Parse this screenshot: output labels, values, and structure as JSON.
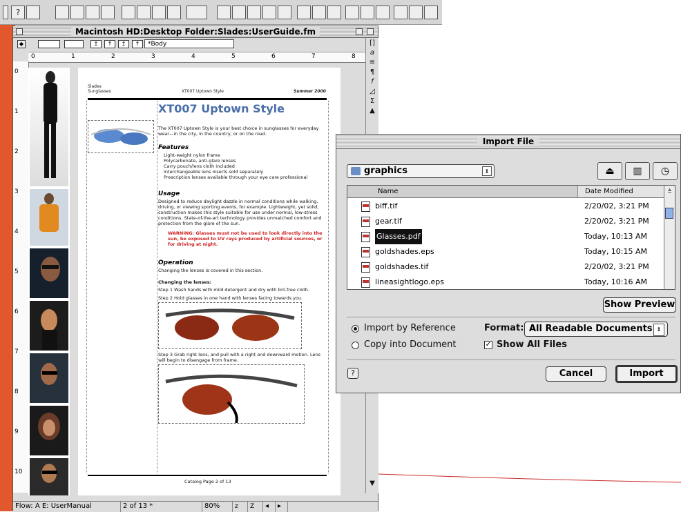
{
  "toolbar": {
    "buttons": [
      "?",
      "▤",
      "▢",
      "📂",
      "💾",
      "🖨",
      "✂",
      "⎘",
      "📋",
      "✎"
    ]
  },
  "document_window": {
    "title": "Macintosh HD:Desktop Folder:Slades:UserGuide.fm",
    "paragraph_tag": "*Body",
    "ruler_numbers": [
      "0",
      "1",
      "2",
      "3",
      "4",
      "5",
      "6",
      "7",
      "8"
    ],
    "left_ruler_numbers": [
      "0",
      "1",
      "2",
      "3",
      "4",
      "5",
      "6",
      "7",
      "8",
      "9",
      "10"
    ]
  },
  "page": {
    "header_left_1": "Slades",
    "header_left_2": "Sunglasses",
    "header_center": "XT007 Uptown Style",
    "header_right": "Summer 2000",
    "title": "XT007 Uptown Style",
    "intro": "The XT007 Uptown Style is your best choice in sunglasses for everyday wear—in the city, in the country, or on the road.",
    "features_heading": "Features",
    "features": [
      "Light-weight nylon frame",
      "Polycarbonate, anti-glare lenses",
      "Carry pouch/lens cloth included",
      "Interchangeable lens inserts sold separately",
      "Prescription lenses available through your eye care professional"
    ],
    "usage_heading": "Usage",
    "usage_text": "Designed to reduce daylight dazzle in normal conditions while walking, driving, or viewing sporting events, for example. Lightweight, yet solid, construction makes this style suitable for use under normal, low-stress conditions. State-of-the-art technology provides unmatched comfort and protection from the glare of the sun.",
    "warning": "WARNING: Glasses must not be used to look directly into the sun, be exposed to UV rays produced by artificial sources, or for driving at night.",
    "operation_heading": "Operation",
    "operation_text": "Changing the lenses is covered in this section.",
    "changing_heading": "Changing the lenses:",
    "step1": "Step 1   Wash hands with mild detergent and dry with lint-free cloth.",
    "step2": "Step 2   Hold glasses in one hand with lenses facing towards you.",
    "step3": "Step 3   Grab right lens, and pull with a right and downward motion. Lens will begin to disengage from frame.",
    "footer": "Catalog Page 2 of 13"
  },
  "status_bar": {
    "flow": "Flow: A  E: UserManual",
    "page": "2 of 13 *",
    "zoom": "80%"
  },
  "dialog": {
    "title": "Import File",
    "folder": "graphics",
    "col_name": "Name",
    "col_date": "Date Modified",
    "files": [
      {
        "name": "biff.tif",
        "date": "2/20/02, 3:21 PM"
      },
      {
        "name": "gear.tif",
        "date": "2/20/02, 3:21 PM"
      },
      {
        "name": "Glasses.pdf",
        "date": "Today, 10:13 AM"
      },
      {
        "name": "goldshades.eps",
        "date": "Today, 10:15 AM"
      },
      {
        "name": "goldshades.tif",
        "date": "2/20/02, 3:21 PM"
      },
      {
        "name": "lineasightlogo.eps",
        "date": "Today, 10:16 AM"
      }
    ],
    "show_preview": "Show Preview",
    "import_by_reference": "Import by Reference",
    "copy_into_document": "Copy into Document",
    "format_label": "Format:",
    "format_value": "All Readable Documents",
    "show_all_files": "Show All Files",
    "cancel": "Cancel",
    "import": "Import"
  }
}
